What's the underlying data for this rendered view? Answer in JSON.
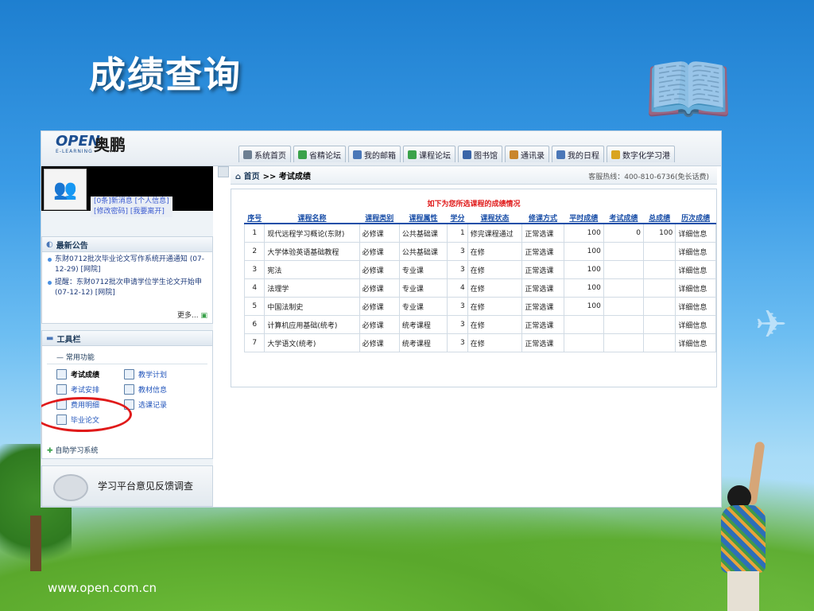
{
  "slide": {
    "title": "成绩查询",
    "url": "www.open.com.cn"
  },
  "app": {
    "logo_open": "OPEN",
    "logo_sub": "E-LEARNING",
    "logo_cn": "奥鹏",
    "tabs": [
      {
        "label": "系统首页",
        "icon": "home-icon",
        "color": "#6d7f92"
      },
      {
        "label": "省精论坛",
        "icon": "forum-icon",
        "color": "#3aa24a"
      },
      {
        "label": "我的邮箱",
        "icon": "mail-icon",
        "color": "#4a77b8"
      },
      {
        "label": "课程论坛",
        "icon": "course-forum-icon",
        "color": "#3aa24a"
      },
      {
        "label": "图书馆",
        "icon": "library-icon",
        "color": "#3a65a8"
      },
      {
        "label": "通讯录",
        "icon": "contacts-icon",
        "color": "#c9862c"
      },
      {
        "label": "我的日程",
        "icon": "calendar-icon",
        "color": "#4a77b8"
      },
      {
        "label": "数字化学习港",
        "icon": "learning-port-icon",
        "color": "#d9a420"
      }
    ]
  },
  "user": {
    "messages": "[0条]新消息",
    "personal_info": "[个人信息]",
    "change_password": "[修改密码]",
    "logout": "[我要离开]"
  },
  "announcements": {
    "title": "最新公告",
    "items": [
      "东财0712批次毕业论文写作系统开通通知 (07-12-29) [网院]",
      "提醒：东财0712批次申请学位学生论文开始申 (07-12-12) [网院]"
    ],
    "more": "更多..."
  },
  "toolbar": {
    "title": "工具栏",
    "section": "常用功能",
    "tools": [
      {
        "label": "考试成绩",
        "icon": "exam-score-icon"
      },
      {
        "label": "教学计划",
        "icon": "teaching-plan-icon"
      },
      {
        "label": "考试安排",
        "icon": "exam-schedule-icon"
      },
      {
        "label": "教材信息",
        "icon": "textbook-icon"
      },
      {
        "label": "费用明细",
        "icon": "fee-icon"
      },
      {
        "label": "选课记录",
        "icon": "course-record-icon"
      },
      {
        "label": "毕业论文",
        "icon": "thesis-icon"
      }
    ],
    "self_study": "自助学习系统"
  },
  "feedback": {
    "label": "学习平台意见反馈调查"
  },
  "main": {
    "breadcrumb_home": "首页",
    "breadcrumb_sep": ">>",
    "breadcrumb_current": "考试成绩",
    "hotline": "客服热线：400-810-6736(免长话费)",
    "grades_title": "如下为您所选课程的成绩情况",
    "columns": [
      "序号",
      "课程名称",
      "课程类别",
      "课程属性",
      "学分",
      "课程状态",
      "修课方式",
      "平时成绩",
      "考试成绩",
      "总成绩",
      "历次成绩"
    ],
    "rows": [
      [
        "1",
        "现代远程学习概论(东财)",
        "必修课",
        "公共基础课",
        "1",
        "修完课程通过",
        "正常选课",
        "100",
        "0",
        "100",
        "详细信息"
      ],
      [
        "2",
        "大学体验英语基础教程",
        "必修课",
        "公共基础课",
        "3",
        "在修",
        "正常选课",
        "100",
        "",
        "",
        "详细信息"
      ],
      [
        "3",
        "宪法",
        "必修课",
        "专业课",
        "3",
        "在修",
        "正常选课",
        "100",
        "",
        "",
        "详细信息"
      ],
      [
        "4",
        "法理学",
        "必修课",
        "专业课",
        "4",
        "在修",
        "正常选课",
        "100",
        "",
        "",
        "详细信息"
      ],
      [
        "5",
        "中国法制史",
        "必修课",
        "专业课",
        "3",
        "在修",
        "正常选课",
        "100",
        "",
        "",
        "详细信息"
      ],
      [
        "6",
        "计算机应用基础(统考)",
        "必修课",
        "统考课程",
        "3",
        "在修",
        "正常选课",
        "",
        "",
        "",
        "详细信息"
      ],
      [
        "7",
        "大学语文(统考)",
        "必修课",
        "统考课程",
        "3",
        "在修",
        "正常选课",
        "",
        "",
        "",
        "详细信息"
      ]
    ]
  }
}
